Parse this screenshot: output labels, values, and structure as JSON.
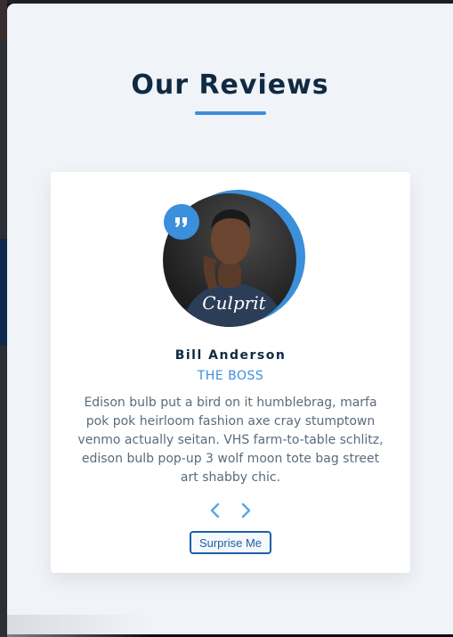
{
  "header": {
    "title": "Our Reviews"
  },
  "review": {
    "name": "Bill Anderson",
    "role": "THE BOSS",
    "text": "Edison bulb put a bird on it humblebrag, marfa pok pok heirloom fashion axe cray stumptown venmo actually seitan. VHS farm-to-table schlitz, edison bulb pop-up 3 wolf moon tote bag street art shabby chic.",
    "shirt_text": "Culprit"
  },
  "controls": {
    "prev_icon": "chevron-left-icon",
    "next_icon": "chevron-right-icon",
    "surprise_label": "Surprise Me"
  },
  "colors": {
    "accent": "#3b8fdb",
    "title": "#102a43",
    "background": "#f0f3f8"
  }
}
